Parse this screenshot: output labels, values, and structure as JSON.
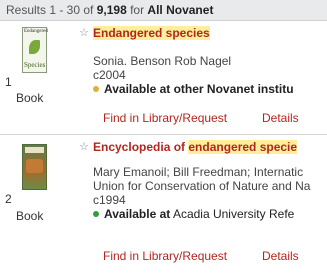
{
  "header": {
    "prefix": "Results 1 - 30 of ",
    "total": "9,198",
    "for_text": " for ",
    "scope": "All Novanet"
  },
  "colors": {
    "accent": "#b3261e",
    "highlight": "#ffef9a",
    "available_other": "#d9b23b",
    "available_here": "#2e9e3e"
  },
  "results": [
    {
      "number": "1",
      "cover_title": "Endangered",
      "cover_label": "Species",
      "format": "Book",
      "title_pre": "",
      "title_highlight": "Endangered species",
      "title_post": "",
      "authors": "Sonia. Benson Rob Nagel",
      "authors_line2": "",
      "date": "c2004",
      "availability_bold": "Available at other Novanet institu",
      "availability_rest": "",
      "find_label": "Find in Library/Request",
      "details_label": "Details"
    },
    {
      "number": "2",
      "format": "Book",
      "title_pre": "Encyclopedia of ",
      "title_highlight": "endangered specie",
      "title_post": "",
      "authors": "Mary Emanoil; Bill Freedman; Internatic",
      "authors_line2": "Union for Conservation of Nature and Na",
      "date": "c1994",
      "availability_bold": "Available at",
      "availability_rest": " Acadia University Refe",
      "find_label": "Find in Library/Request",
      "details_label": "Details"
    }
  ]
}
